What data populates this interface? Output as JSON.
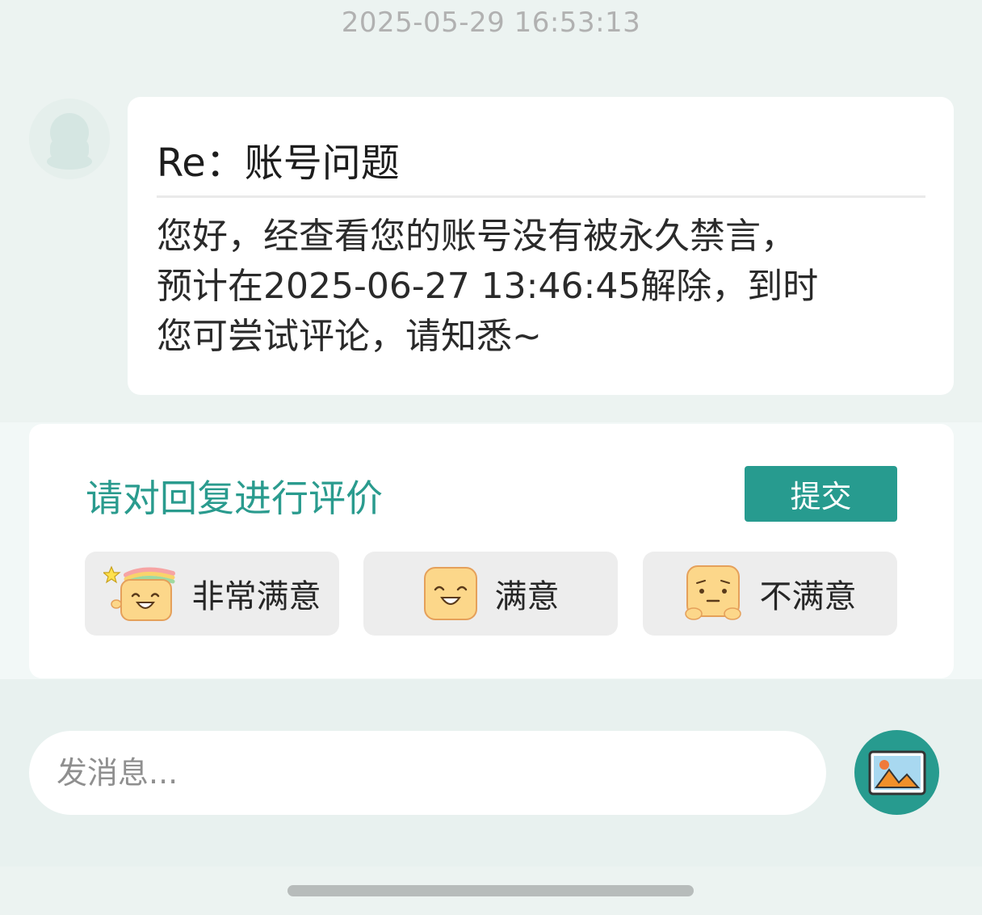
{
  "header": {
    "timestamp": "2025-05-29 16:53:13"
  },
  "message": {
    "avatar_icon": "person-avatar-icon",
    "title": "Re：账号问题",
    "body_lines": [
      "您好，经查看您的账号没有被永久禁言，",
      "预计在2025-06-27 13:46:45解除，到时",
      "您可尝试评论，请知悉~"
    ]
  },
  "rating": {
    "heading": "请对回复进行评价",
    "submit_label": "提交",
    "options": [
      {
        "label": "非常满意",
        "icon": "very-satisfied-emoji-icon"
      },
      {
        "label": "满意",
        "icon": "satisfied-emoji-icon"
      },
      {
        "label": "不满意",
        "icon": "dissatisfied-emoji-icon"
      }
    ]
  },
  "composer": {
    "placeholder": "发消息...",
    "image_icon": "image-picture-icon"
  },
  "colors": {
    "accent": "#279b8f",
    "background": "#ecf3f1",
    "card": "#ffffff",
    "option_bg": "#ededed",
    "emoji_yellow": "#fcd78a"
  }
}
